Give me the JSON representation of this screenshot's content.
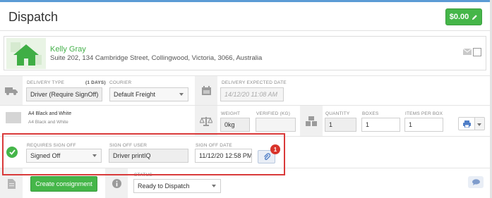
{
  "page": {
    "title": "Dispatch"
  },
  "header": {
    "amount_label": "$0.00",
    "amount_icon": "pencil-icon",
    "accent_color": "#45b649"
  },
  "customer": {
    "name": "Kelly Gray",
    "address": "Suite 202, 134 Cambridge Street, Collingwood, Victoria, 3066, Australia",
    "avatar_icon": "house-icon",
    "mail_icon": "envelope-icon"
  },
  "delivery": {
    "type_label": "DELIVERY TYPE",
    "days_label": "(1 DAYS)",
    "type_value": "Driver (Require SignOff)",
    "courier_label": "COURIER",
    "courier_value": "Default Freight",
    "expected_label": "DELIVERY EXPECTED DATE",
    "expected_value": "14/12/20 11:08 AM"
  },
  "product": {
    "name": "A4 Black and White",
    "size": "A4 Black and White",
    "weight_label": "WEIGHT",
    "weight_value": "0kg",
    "verified_label": "VERIFIED (KG)",
    "verified_value": "",
    "quantity_label": "QUANTITY",
    "quantity_value": "1",
    "boxes_label": "BOXES",
    "boxes_value": "1",
    "items_per_box_label": "ITEMS PER BOX",
    "items_per_box_value": "1"
  },
  "signoff": {
    "requires_label": "REQUIRES SIGN OFF",
    "requires_value": "Signed Off",
    "user_label": "SIGN OFF USER",
    "user_value": "Driver printIQ",
    "date_label": "SIGN OFF DATE",
    "date_value": "11/12/20 12:58 PM",
    "attachment_count": "1",
    "badge_color": "#d9342b",
    "highlight_color": "#d93a3a"
  },
  "footer": {
    "create_label": "Create consignment",
    "status_label": "STATUS",
    "status_value": "Ready to Dispatch"
  }
}
